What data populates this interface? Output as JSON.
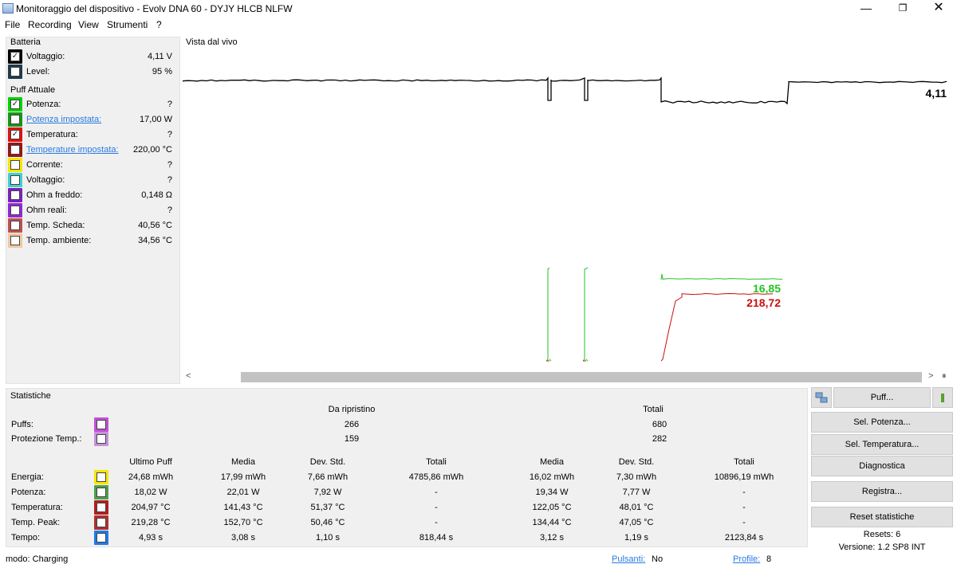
{
  "window": {
    "title": "Monitoraggio del dispositivo - Evolv DNA 60 - DYJY HLCB NLFW",
    "minimize": "—",
    "maximize": "❐",
    "close": "✕"
  },
  "menu": [
    "File",
    "Recording",
    "View",
    "Strumenti",
    "?"
  ],
  "battery": {
    "title": "Batteria",
    "items": [
      {
        "label": "Voltaggio:",
        "value": "4,11 V",
        "checked": true,
        "color": "#000000"
      },
      {
        "label": "Level:",
        "value": "95 %",
        "checked": false,
        "color": "#1c3b4a"
      }
    ]
  },
  "puff": {
    "title": "Puff Attuale",
    "items": [
      {
        "label": "Potenza:",
        "value": "?",
        "checked": true,
        "color": "#00d400",
        "link": false
      },
      {
        "label": "Potenza impostata:",
        "value": "17,00 W",
        "checked": false,
        "color": "#139a13",
        "link": true
      },
      {
        "label": "Temperatura:",
        "value": "?",
        "checked": true,
        "color": "#e01010",
        "link": false
      },
      {
        "label": "Temperature impostata:",
        "value": "220,00 °C",
        "checked": false,
        "color": "#9a1414",
        "link": true
      },
      {
        "label": "Corrente:",
        "value": "?",
        "checked": false,
        "color": "#f5e600",
        "link": false
      },
      {
        "label": "Voltaggio:",
        "value": "?",
        "checked": false,
        "color": "#3fd0d0",
        "link": false
      },
      {
        "label": "Ohm a freddo:",
        "value": "0,148 Ω",
        "checked": false,
        "color": "#7a1fc0",
        "link": false
      },
      {
        "label": "Ohm reali:",
        "value": "?",
        "checked": false,
        "color": "#8f2ad8",
        "link": false
      },
      {
        "label": "Temp. Scheda:",
        "value": "40,56 °C",
        "checked": false,
        "color": "#c05050",
        "link": false
      },
      {
        "label": "Temp. ambiente:",
        "value": "34,56 °C",
        "checked": false,
        "color": "#efc9a0",
        "link": false
      }
    ]
  },
  "chart": {
    "title": "Vista dal vivo",
    "labels": {
      "voltage": "4,11",
      "power": "16,85",
      "temperature": "218,72"
    },
    "colors": {
      "voltage": "#000000",
      "power": "#22c422",
      "temperature": "#c81010"
    }
  },
  "scroll": {
    "left": "<",
    "right": ">",
    "end": "⏸"
  },
  "stats": {
    "title": "Statistiche",
    "top_headers": [
      "Da ripristino",
      "Totali"
    ],
    "counts": [
      {
        "label": "Puffs:",
        "values": [
          "266",
          "680"
        ],
        "color": "#c24fd8"
      },
      {
        "label": "Protezione Temp.:",
        "values": [
          "159",
          "282"
        ],
        "color": "#c890d8"
      }
    ],
    "headers": [
      "Ultimo Puff",
      "Media",
      "Dev. Std.",
      "Totali",
      "Media",
      "Dev. Std.",
      "Totali"
    ],
    "rows": [
      {
        "label": "Energia:",
        "color": "#f5e600",
        "values": [
          "24,68 mWh",
          "17,99 mWh",
          "7,66 mWh",
          "4785,86 mWh",
          "16,02 mWh",
          "7,30 mWh",
          "10896,19 mWh"
        ]
      },
      {
        "label": "Potenza:",
        "color": "#4ca04c",
        "values": [
          "18,02 W",
          "22,01 W",
          "7,92 W",
          "-",
          "19,34 W",
          "7,77 W",
          "-"
        ]
      },
      {
        "label": "Temperatura:",
        "color": "#b02020",
        "values": [
          "204,97 °C",
          "141,43 °C",
          "51,37 °C",
          "-",
          "122,05 °C",
          "48,01 °C",
          "-"
        ]
      },
      {
        "label": "Temp. Peak:",
        "color": "#b03030",
        "values": [
          "219,28 °C",
          "152,70 °C",
          "50,46 °C",
          "-",
          "134,44 °C",
          "47,05 °C",
          "-"
        ]
      },
      {
        "label": "Tempo:",
        "color": "#1e7ae8",
        "values": [
          "4,93 s",
          "3,08 s",
          "1,10 s",
          "818,44 s",
          "3,12 s",
          "1,19 s",
          "2123,84 s"
        ]
      }
    ]
  },
  "buttons": {
    "puff": "Puff...",
    "sel_power": "Sel. Potenza...",
    "sel_temp": "Sel. Temperatura...",
    "diagnostics": "Diagnostica",
    "record": "Registra...",
    "reset": "Reset statistiche"
  },
  "info": {
    "resets": "Resets: 6",
    "version": "Versione: 1.2 SP8 INT"
  },
  "status": {
    "mode": "modo: Charging",
    "buttons_label": "Pulsanti:",
    "buttons_value": "No",
    "profile_label": "Profile:",
    "profile_value": "8"
  }
}
